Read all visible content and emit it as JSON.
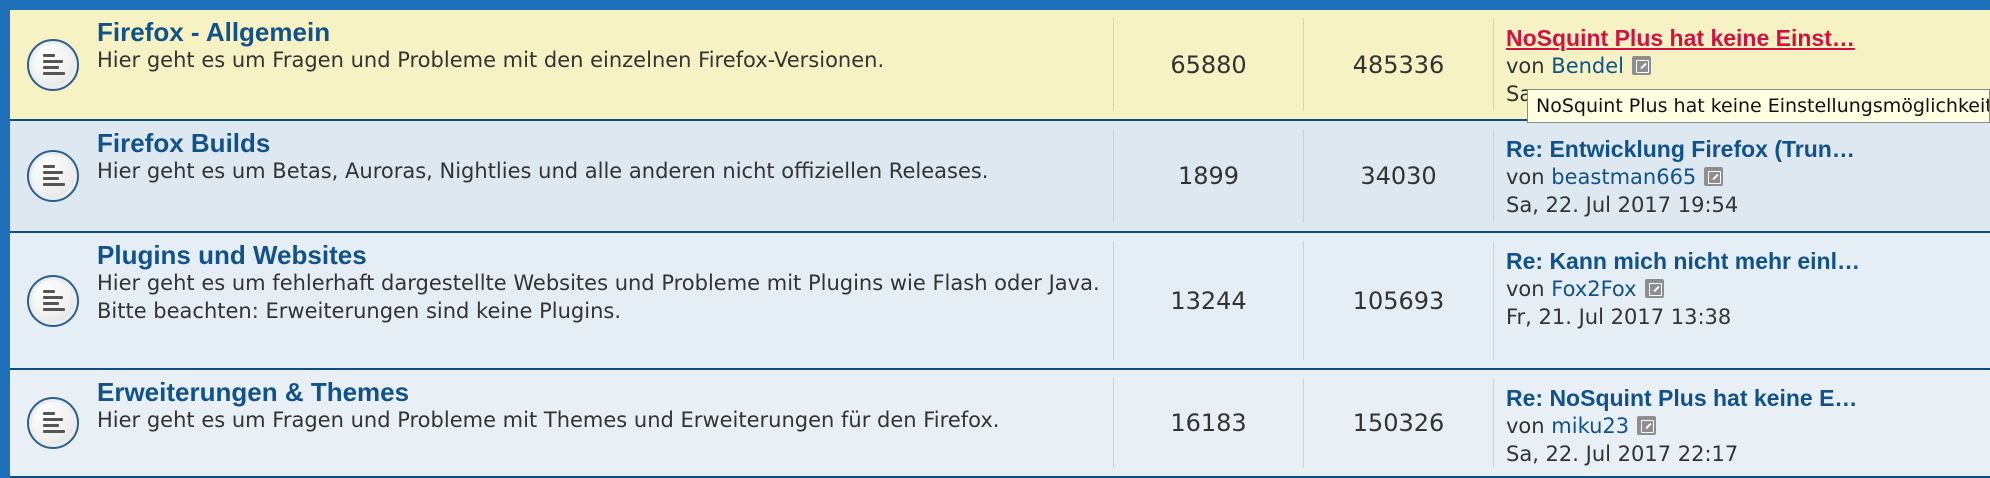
{
  "forums": [
    {
      "title": "Firefox - Allgemein",
      "description": "Hier geht es um Fragen und Probleme mit den einzelnen Firefox-Versionen.",
      "topics": "65880",
      "posts": "485336",
      "last_post": {
        "title": "NoSquint Plus hat keine Einst…",
        "by": "von",
        "user": "Bendel",
        "date": "Sa"
      }
    },
    {
      "title": "Firefox Builds",
      "description": "Hier geht es um Betas, Auroras, Nightlies und alle anderen nicht offiziellen Releases.",
      "topics": "1899",
      "posts": "34030",
      "last_post": {
        "title": "Re: Entwicklung Firefox (Trun…",
        "by": "von",
        "user": "beastman665",
        "date": "Sa, 22. Jul 2017 19:54"
      }
    },
    {
      "title": "Plugins und Websites",
      "description": "Hier geht es um fehlerhaft dargestellte Websites und Probleme mit Plugins wie Flash oder Java.",
      "note": "Bitte beachten: Erweiterungen sind keine Plugins.",
      "topics": "13244",
      "posts": "105693",
      "last_post": {
        "title": "Re: Kann mich nicht mehr einl…",
        "by": "von",
        "user": "Fox2Fox",
        "date": "Fr, 21. Jul 2017 13:38"
      }
    },
    {
      "title": "Erweiterungen & Themes",
      "description": "Hier geht es um Fragen und Probleme mit Themes und Erweiterungen für den Firefox.",
      "topics": "16183",
      "posts": "150326",
      "last_post": {
        "title": "Re: NoSquint Plus hat keine E…",
        "by": "von",
        "user": "miku23",
        "date": "Sa, 22. Jul 2017 22:17"
      }
    }
  ],
  "tooltip": "NoSquint Plus hat keine Einstellungsmöglichkeiten",
  "icons": {
    "forum": "forum-read-icon",
    "view": "view-latest-post-icon"
  },
  "colors": {
    "highlight_row": "#F6F2C4",
    "link": "#105289",
    "unread_link": "#D31141",
    "frame": "#1E70B8"
  }
}
